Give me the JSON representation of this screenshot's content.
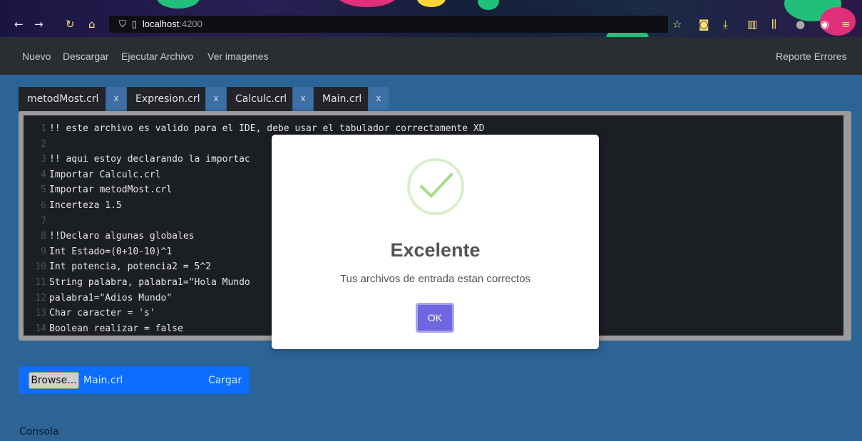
{
  "browser": {
    "url_host": "localhost",
    "url_port": ":4200"
  },
  "navbar": {
    "left_items": [
      "Nuevo",
      "Descargar",
      "Ejecutar Archivo",
      "Ver imagenes"
    ],
    "right_item": "Reporte Errores"
  },
  "tabs": [
    {
      "label": "metodMost.crl",
      "close": "x"
    },
    {
      "label": "Expresion.crl",
      "close": "x"
    },
    {
      "label": "Calculc.crl",
      "close": "x"
    },
    {
      "label": "Main.crl",
      "close": "x"
    }
  ],
  "editor": {
    "lines": [
      {
        "n": "1",
        "text": "!! este archivo es valido para el IDE, debe usar el tabulador correctamente XD"
      },
      {
        "n": "2",
        "text": ""
      },
      {
        "n": "3",
        "text": "!! aqui estoy declarando la importac"
      },
      {
        "n": "4",
        "text": "Importar Calculc.crl"
      },
      {
        "n": "5",
        "text": "Importar metodMost.crl"
      },
      {
        "n": "6",
        "text": "Incerteza 1.5"
      },
      {
        "n": "7",
        "text": ""
      },
      {
        "n": "8",
        "text": "!!Declaro algunas globales"
      },
      {
        "n": "9",
        "text": "Int Estado=(0+10-10)^1"
      },
      {
        "n": "10",
        "text": "Int potencia, potencia2 = 5^2"
      },
      {
        "n": "11",
        "text": "String palabra, palabra1=\"Hola Mundo"
      },
      {
        "n": "12",
        "text": "palabra1=\"Adios Mundo\""
      },
      {
        "n": "13",
        "text": "Char caracter = 's'"
      },
      {
        "n": "14",
        "text": "Boolean realizar = false"
      }
    ]
  },
  "modal": {
    "title": "Excelente",
    "message": "Tus archivos de entrada estan correctos",
    "ok_label": "OK",
    "success_color": "#a5dc86",
    "button_color": "#7066e0"
  },
  "loader": {
    "browse_label": "Browse...",
    "file_name": "Main.crl",
    "submit_label": "Cargar"
  },
  "console": {
    "label": "Consola"
  }
}
